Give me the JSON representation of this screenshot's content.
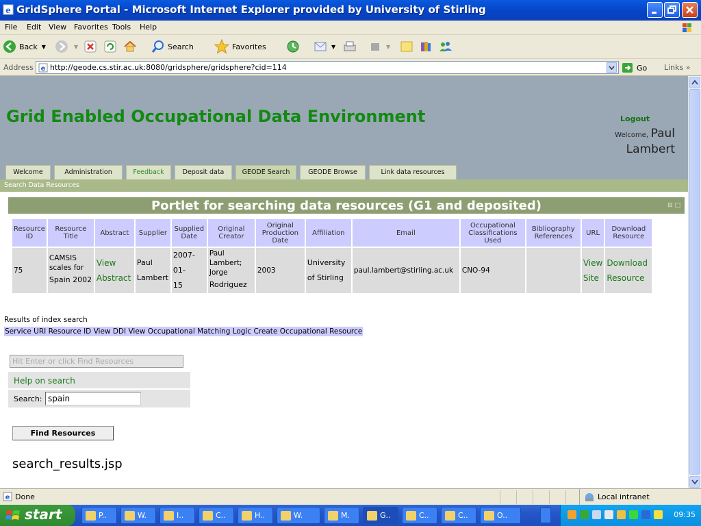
{
  "window": {
    "title": "GridSphere Portal - Microsoft Internet Explorer provided by University of Stirling"
  },
  "menu": [
    "File",
    "Edit",
    "View",
    "Favorites",
    "Tools",
    "Help"
  ],
  "toolbar": {
    "back": "Back",
    "search": "Search",
    "favorites": "Favorites"
  },
  "address": {
    "label": "Address",
    "url": "http://geode.cs.stir.ac.uk:8080/gridsphere/gridsphere?cid=114",
    "go": "Go",
    "links": "Links"
  },
  "header": {
    "title": "Grid Enabled Occupational Data Environment",
    "logout": "Logout",
    "welcome": "Welcome,",
    "user_first": "Paul",
    "user_last": "Lambert"
  },
  "tabs": [
    "Welcome",
    "Administration",
    "Feedback",
    "Deposit data",
    "GEODE Search",
    "GEODE Browse",
    "Link data resources"
  ],
  "active_tab": "GEODE Search",
  "subnav": "Search Data Resources",
  "portlet": {
    "title": "Portlet for searching data resources (G1 and deposited)"
  },
  "table": {
    "headers": [
      "Resource ID",
      "Resource Title",
      "Abstract",
      "Supplier",
      "Supplied Date",
      "Original Creator",
      "Original Production Date",
      "Affiliation",
      "Email",
      "Occupational Classifications Used",
      "Bibliography References",
      "URL",
      "Download Resource"
    ],
    "row": {
      "id": "75",
      "title_a": "CAMSIS scales for",
      "title_b": "Spain 2002",
      "abstract_a": "View",
      "abstract_b": "Abstract",
      "supplier_a": "Paul",
      "supplier_b": "Lambert",
      "date_a": "2007-01-",
      "date_b": "15",
      "creator_a": "Paul Lambert;",
      "creator_b": "Jorge",
      "creator_c": "Rodriguez",
      "prod_date": "2003",
      "affil_a": "University",
      "affil_b": "of Stirling",
      "email": "paul.lambert@stirling.ac.uk",
      "classif": "CNO-94",
      "biblio": "",
      "url_a": "View",
      "url_b": "Site",
      "dl_a": "Download",
      "dl_b": "Resource"
    }
  },
  "index": {
    "label": "Results of index search",
    "links": [
      "Service URI",
      "Resource ID",
      "View DDI",
      "View Occupational Matching Logic",
      "Create Occupational Resource"
    ]
  },
  "search": {
    "hint": "Hit Enter or click Find Resources",
    "help": "Help on search",
    "label": "Search:",
    "value": "spain",
    "button": "Find Resources"
  },
  "jsp": "search_results.jsp",
  "status": {
    "text": "Done",
    "zone": "Local intranet"
  },
  "taskbar": {
    "start": "start",
    "tasks": [
      "P..",
      "W.",
      "I..",
      "C..",
      "H..",
      "W.",
      "M.",
      "G..",
      "C..",
      "C..",
      "O.."
    ],
    "clock": "09:35"
  }
}
